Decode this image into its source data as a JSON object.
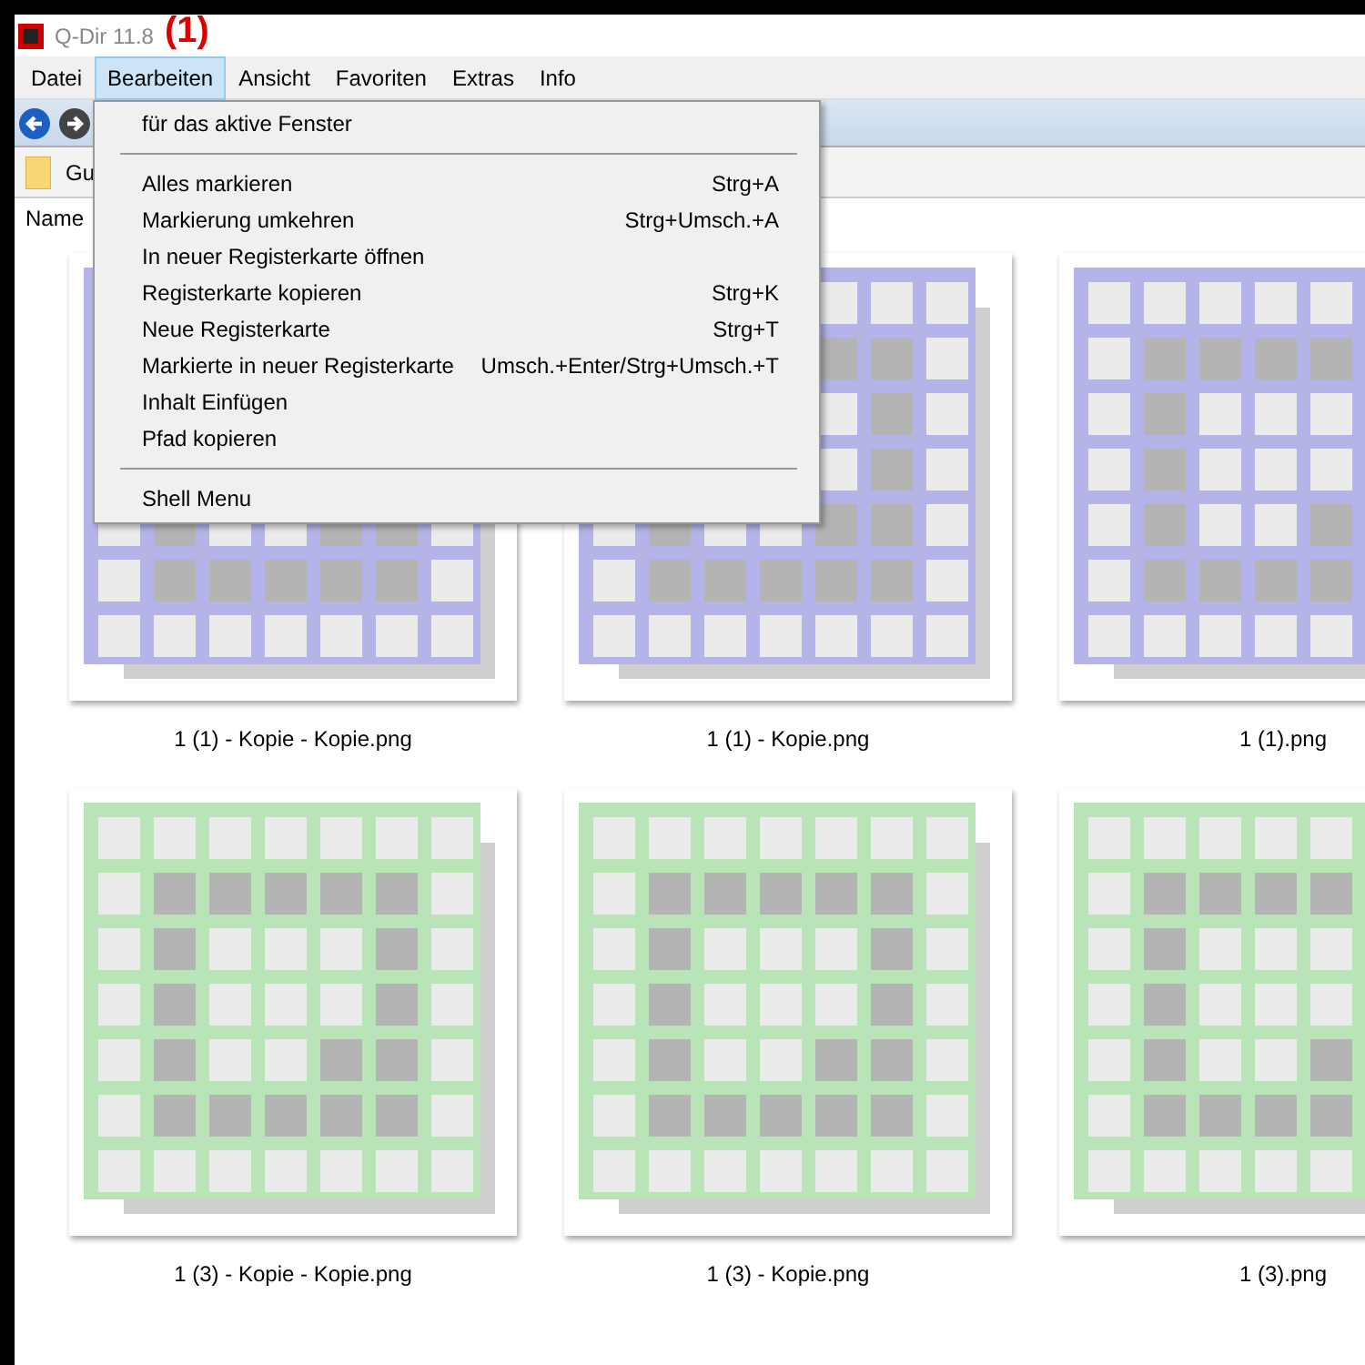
{
  "window": {
    "title": "Q-Dir 11.8",
    "annotation": "(1)"
  },
  "menu_bar": [
    {
      "label": "Datei",
      "selected": false
    },
    {
      "label": "Bearbeiten",
      "selected": true
    },
    {
      "label": "Ansicht",
      "selected": false
    },
    {
      "label": "Favoriten",
      "selected": false
    },
    {
      "label": "Extras",
      "selected": false
    },
    {
      "label": "Info",
      "selected": false
    }
  ],
  "address_bar": {
    "text": "Gu"
  },
  "column_header": "Name",
  "dropdown_menu": [
    {
      "kind": "item",
      "label": "für das aktive Fenster"
    },
    {
      "kind": "separator"
    },
    {
      "kind": "item",
      "label": "Alles markieren",
      "shortcut": "Strg+A"
    },
    {
      "kind": "item",
      "label": "Markierung umkehren",
      "shortcut": "Strg+Umsch.+A"
    },
    {
      "kind": "item",
      "label": "In neuer Registerkarte öffnen"
    },
    {
      "kind": "item",
      "label": "Registerkarte kopieren",
      "shortcut": "Strg+K"
    },
    {
      "kind": "item",
      "label": "Neue Registerkarte",
      "shortcut": "Strg+T"
    },
    {
      "kind": "item",
      "label": "Markierte in neuer Registerkarte",
      "shortcut": "Umsch.+Enter/Strg+Umsch.+T"
    },
    {
      "kind": "item",
      "label": "Inhalt Einfügen"
    },
    {
      "kind": "item",
      "label": "Pfad kopieren"
    },
    {
      "kind": "separator"
    },
    {
      "kind": "item",
      "label": "Shell Menu"
    }
  ],
  "files": [
    {
      "name": "1 (1) - Kopie - Kopie.png",
      "color": "#b4b4e8"
    },
    {
      "name": "1 (1) - Kopie.png",
      "color": "#b4b4e8"
    },
    {
      "name": "1 (1).png",
      "color": "#b4b4e8"
    },
    {
      "name": "1 (3) - Kopie - Kopie.png",
      "color": "#b8e4b8"
    },
    {
      "name": "1 (3) - Kopie.png",
      "color": "#b8e4b8"
    },
    {
      "name": "1 (3).png",
      "color": "#b8e4b8"
    }
  ]
}
